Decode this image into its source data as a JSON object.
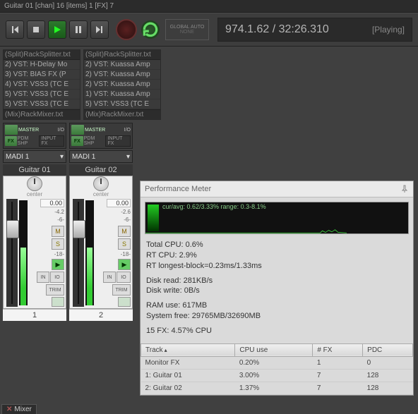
{
  "title_strip": "Guitar 01 [chan] 16 [items] 1 [FX] 7",
  "transport": {
    "timecode": "974.1.62 / 32:26.310",
    "status": "[Playing]",
    "global_auto_top": "GLOBAL AUTO",
    "global_auto_bot": "NONE"
  },
  "fx_lists": [
    {
      "head": "(Split)RackSplitter.txt",
      "rows": [
        "2) VST: H-Delay Mo",
        "3) VST: BIAS FX (P",
        "4) VST: VSS3 (TC E",
        "5) VST: VSS3 (TC E",
        "5) VST: VSS3 (TC E"
      ],
      "foot": "(Mix)RackMixer.txt"
    },
    {
      "head": "(Split)RackSplitter.txt",
      "rows": [
        "2) VST: Kuassa Amp",
        "2) VST: Kuassa Amp",
        "2) VST: Kuassa Amp",
        "1) VST: Kuassa Amp",
        "5) VST: VSS3 (TC E"
      ],
      "foot": "(Mix)RackMixer.txt"
    }
  ],
  "strips": [
    {
      "routing_master": "MASTER",
      "routing_io": "I/O",
      "input_fx": "INPUT FX",
      "fx": "FX",
      "pdm": "PDM",
      "shp": "SHP",
      "route": "MADI 1",
      "name": "Guitar 01",
      "pan": "center",
      "vol": "0.00",
      "peak": "-4.2",
      "m": "M",
      "s": "S",
      "in": "IN",
      "io": "IO",
      "trim": "TRIM",
      "num": "1"
    },
    {
      "routing_master": "MASTER",
      "routing_io": "I/O",
      "input_fx": "INPUT FX",
      "fx": "FX",
      "pdm": "PDM",
      "shp": "SHP",
      "route": "MADI 1",
      "name": "Guitar 02",
      "pan": "center",
      "vol": "0.00",
      "peak": "-2.6",
      "m": "M",
      "s": "S",
      "in": "IN",
      "io": "IO",
      "trim": "TRIM",
      "num": "2"
    }
  ],
  "perf": {
    "title": "Performance Meter",
    "graph_label": "cur/avg: 0.62/3.33%   range: 0.3-8.1%",
    "lines": {
      "total_cpu": "Total CPU: 0.6%",
      "rt_cpu": "RT CPU: 2.9%",
      "rt_block": "RT longest-block=0.23ms/1.33ms",
      "disk_read": "Disk read: 281KB/s",
      "disk_write": "Disk write: 0B/s",
      "ram": "RAM use: 617MB",
      "sysfree": "System free: 29765MB/32690MB",
      "fx": "15 FX: 4.57% CPU"
    },
    "table": {
      "headers": {
        "track": "Track",
        "cpu": "CPU use",
        "nfx": "# FX",
        "pdc": "PDC"
      },
      "rows": [
        {
          "track": "Monitor FX",
          "cpu": "0.20%",
          "nfx": "1",
          "pdc": "0"
        },
        {
          "track": "1: Guitar 01",
          "cpu": "3.00%",
          "nfx": "7",
          "pdc": "128"
        },
        {
          "track": "2: Guitar 02",
          "cpu": "1.37%",
          "nfx": "7",
          "pdc": "128"
        }
      ]
    }
  },
  "bottom_tab": "Mixer"
}
